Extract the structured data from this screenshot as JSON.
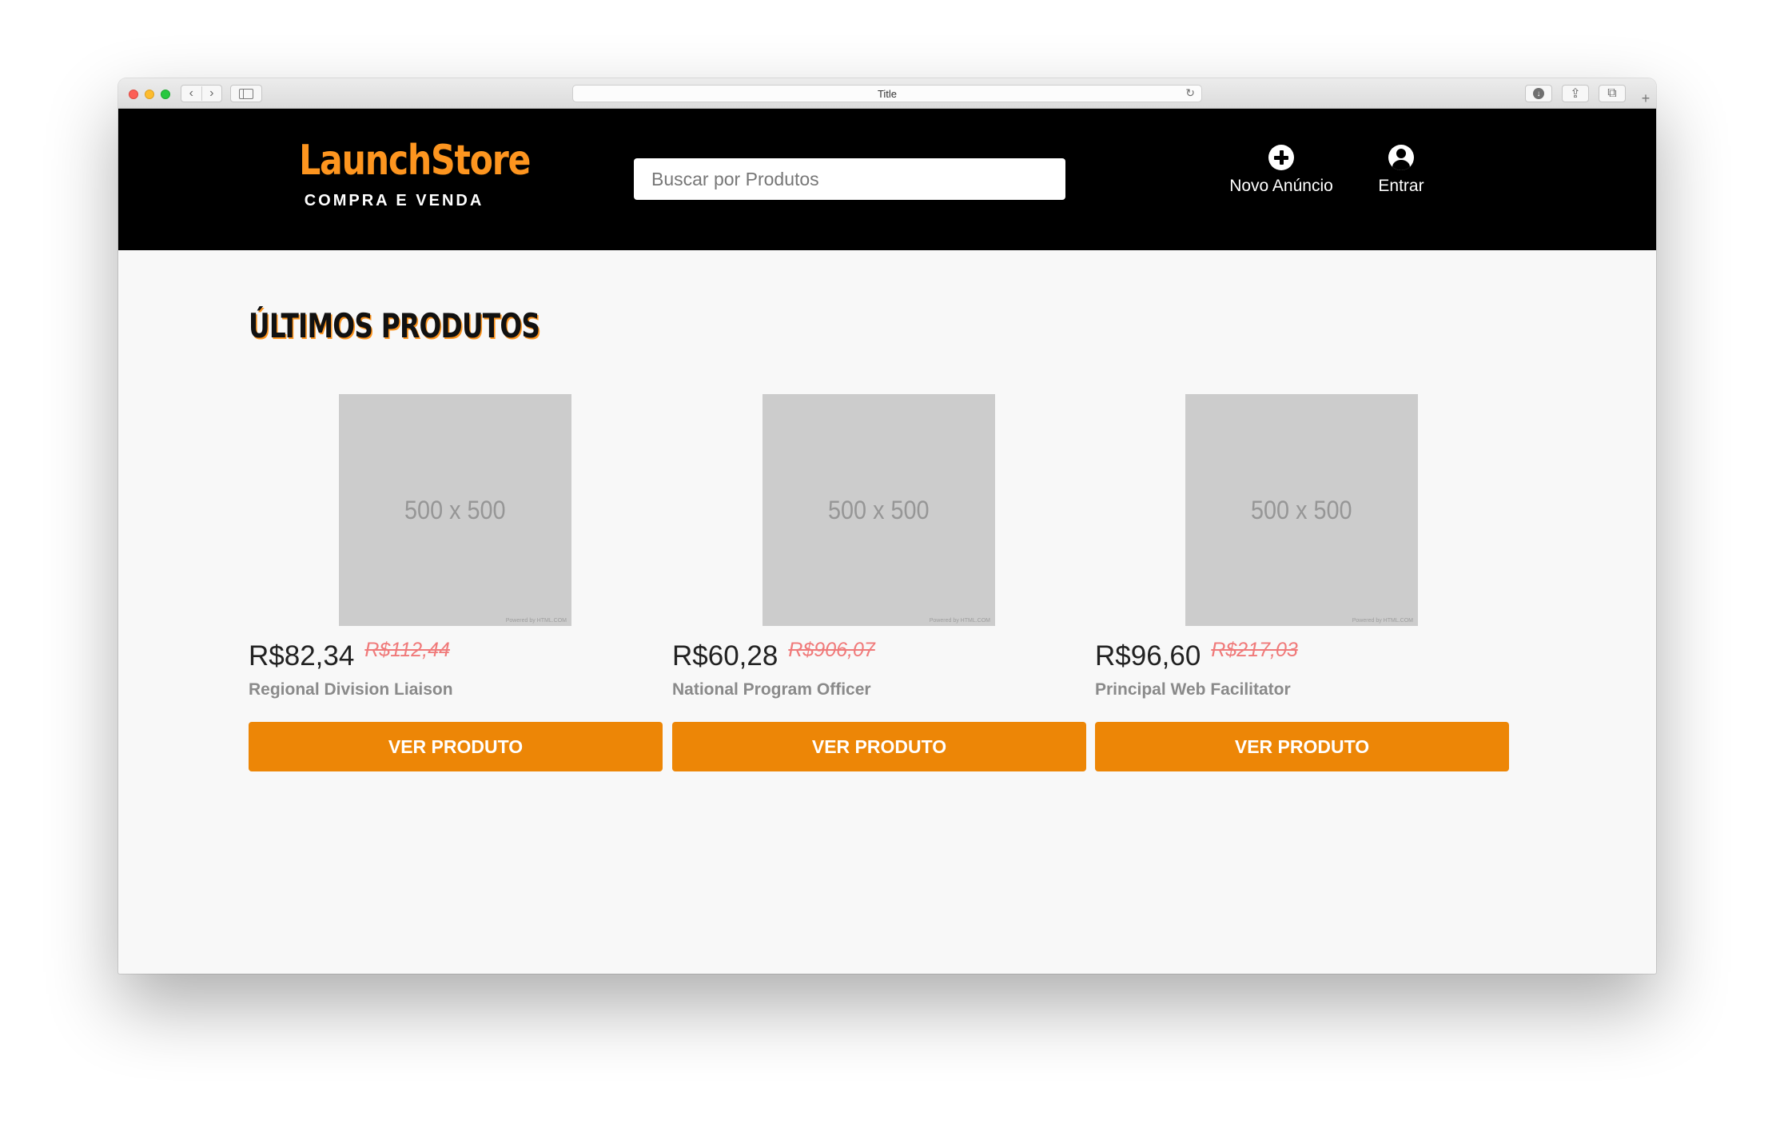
{
  "browser": {
    "title": "Title"
  },
  "header": {
    "logo_title": "LaunchStore",
    "logo_subtitle": "COMPRA E VENDA",
    "search_placeholder": "Buscar por Produtos",
    "actions": [
      {
        "label": "Novo Anúncio",
        "icon": "plus-circle-icon"
      },
      {
        "label": "Entrar",
        "icon": "user-circle-icon"
      }
    ]
  },
  "main": {
    "section_title": "ÚLTIMOS PRODUTOS",
    "products": [
      {
        "image_label": "500 x 500",
        "image_credit": "Powered by HTML.COM",
        "price": "R$82,34",
        "old_price": "R$112,44",
        "name": "Regional Division Liaison",
        "button": "VER PRODUTO"
      },
      {
        "image_label": "500 x 500",
        "image_credit": "Powered by HTML.COM",
        "price": "R$60,28",
        "old_price": "R$906,07",
        "name": "National Program Officer",
        "button": "VER PRODUTO"
      },
      {
        "image_label": "500 x 500",
        "image_credit": "Powered by HTML.COM",
        "price": "R$96,60",
        "old_price": "R$217,03",
        "name": "Principal Web Facilitator",
        "button": "VER PRODUTO"
      }
    ]
  },
  "colors": {
    "brand_orange": "#fd951f",
    "button_orange": "#ed8606",
    "old_price_red": "#f07a7a",
    "header_bg": "#000000"
  }
}
